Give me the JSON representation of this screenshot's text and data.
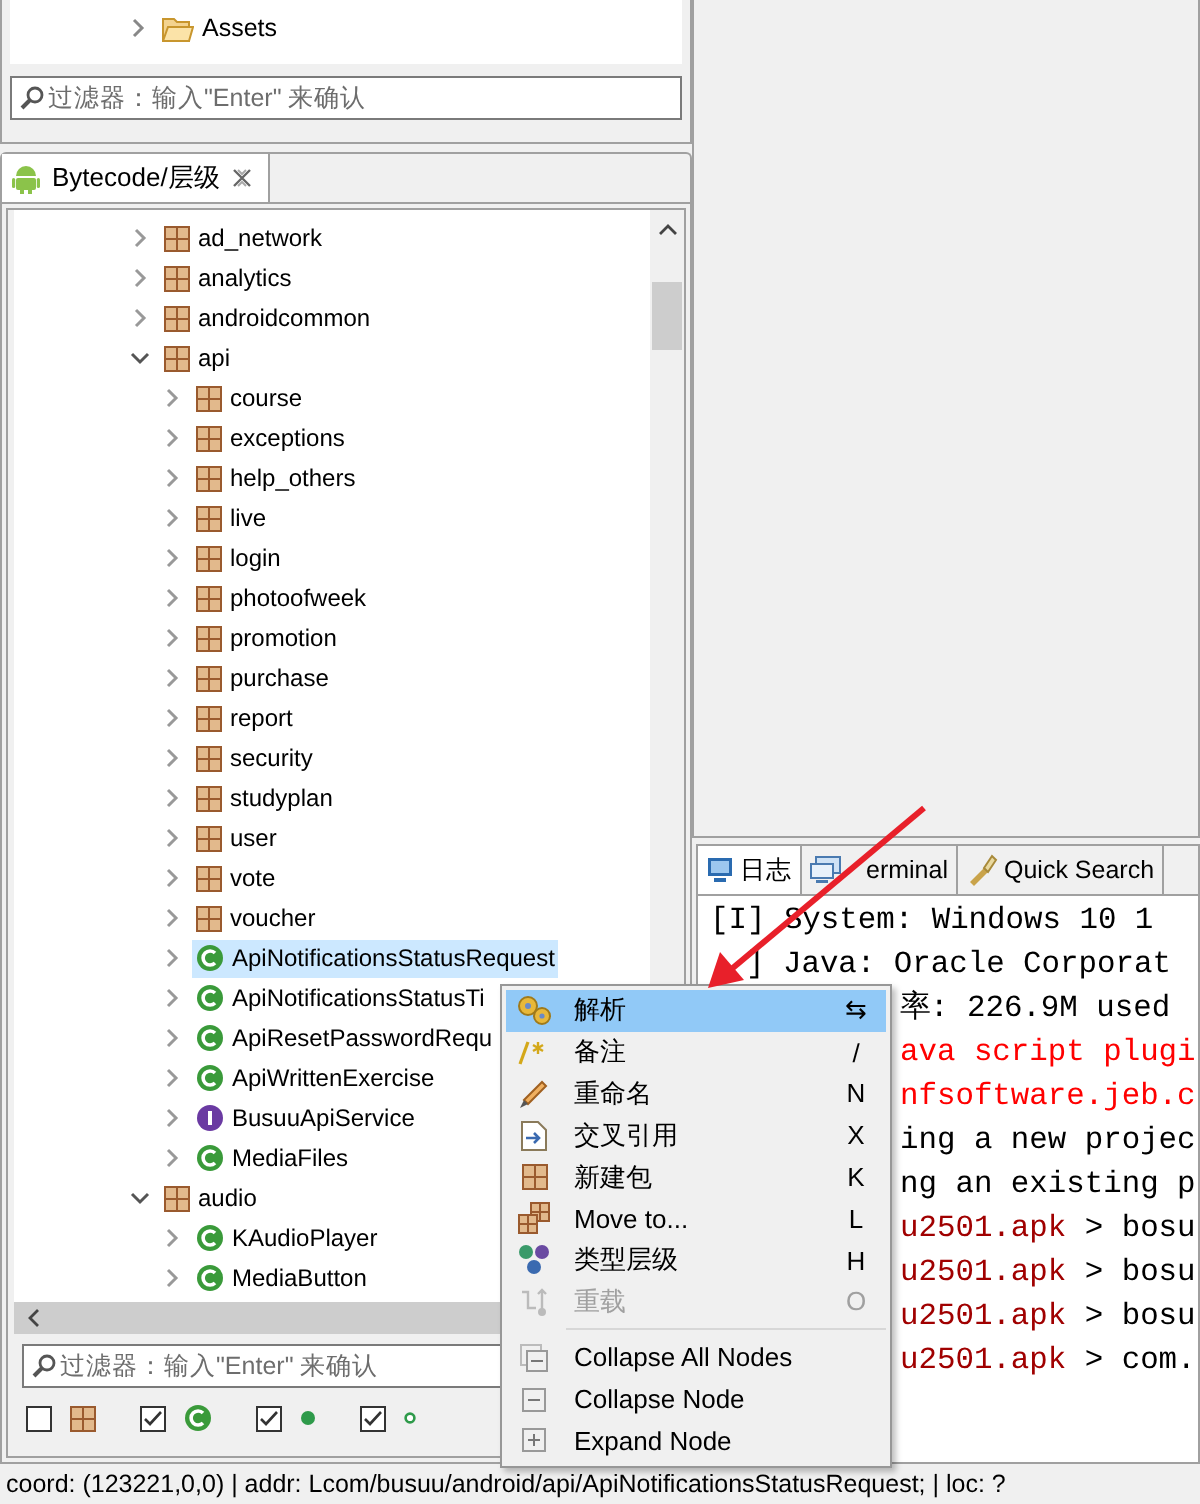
{
  "project_panel": {
    "tree": [
      {
        "label": "Assets",
        "kind": "folder",
        "expanded": false,
        "selected": false
      }
    ],
    "filter": {
      "placeholder": "过滤器：输入\"Enter\" 来确认"
    }
  },
  "bytecode_panel": {
    "tab": {
      "label": "Bytecode/层级",
      "selected": true
    },
    "tree": [
      {
        "label": "ad_network",
        "kind": "package",
        "expanded": false,
        "selected": false
      },
      {
        "label": "analytics",
        "kind": "package",
        "expanded": false,
        "selected": false
      },
      {
        "label": "androidcommon",
        "kind": "package",
        "expanded": false,
        "selected": false
      },
      {
        "label": "api",
        "kind": "package",
        "expanded": true,
        "selected": false,
        "children": [
          {
            "label": "course",
            "kind": "package",
            "expanded": false,
            "selected": false
          },
          {
            "label": "exceptions",
            "kind": "package",
            "expanded": false,
            "selected": false
          },
          {
            "label": "help_others",
            "kind": "package",
            "expanded": false,
            "selected": false
          },
          {
            "label": "live",
            "kind": "package",
            "expanded": false,
            "selected": false
          },
          {
            "label": "login",
            "kind": "package",
            "expanded": false,
            "selected": false
          },
          {
            "label": "photoofweek",
            "kind": "package",
            "expanded": false,
            "selected": false
          },
          {
            "label": "promotion",
            "kind": "package",
            "expanded": false,
            "selected": false
          },
          {
            "label": "purchase",
            "kind": "package",
            "expanded": false,
            "selected": false
          },
          {
            "label": "report",
            "kind": "package",
            "expanded": false,
            "selected": false
          },
          {
            "label": "security",
            "kind": "package",
            "expanded": false,
            "selected": false
          },
          {
            "label": "studyplan",
            "kind": "package",
            "expanded": false,
            "selected": false
          },
          {
            "label": "user",
            "kind": "package",
            "expanded": false,
            "selected": false
          },
          {
            "label": "vote",
            "kind": "package",
            "expanded": false,
            "selected": false
          },
          {
            "label": "voucher",
            "kind": "package",
            "expanded": false,
            "selected": false
          },
          {
            "label": "ApiNotificationsStatusRequest",
            "kind": "class",
            "expanded": false,
            "selected": true
          },
          {
            "label": "ApiNotificationsStatusTi",
            "kind": "class",
            "expanded": false,
            "selected": false
          },
          {
            "label": "ApiResetPasswordRequ",
            "kind": "class",
            "expanded": false,
            "selected": false
          },
          {
            "label": "ApiWrittenExercise",
            "kind": "class",
            "expanded": false,
            "selected": false
          },
          {
            "label": "BusuuApiService",
            "kind": "interface",
            "expanded": false,
            "selected": false
          },
          {
            "label": "MediaFiles",
            "kind": "class",
            "expanded": false,
            "selected": false
          }
        ]
      },
      {
        "label": "audio",
        "kind": "package",
        "expanded": true,
        "selected": false,
        "children": [
          {
            "label": "KAudioPlayer",
            "kind": "class",
            "expanded": false,
            "selected": false
          },
          {
            "label": "MediaButton",
            "kind": "class",
            "expanded": false,
            "selected": false
          }
        ]
      }
    ],
    "filter": {
      "placeholder": "过滤器：输入\"Enter\" 来确认"
    },
    "type_filters": [
      {
        "kind": "package",
        "checked": false
      },
      {
        "kind": "class",
        "checked": true
      },
      {
        "kind": "field",
        "checked": true
      },
      {
        "kind": "method",
        "checked": true
      }
    ]
  },
  "log_panel": {
    "tabs": [
      {
        "label": "日志",
        "kind": "log",
        "selected": true
      },
      {
        "label": "erminal",
        "kind": "terminal",
        "selected": false,
        "partial": true
      },
      {
        "label": "Quick Search",
        "kind": "search",
        "selected": false
      }
    ],
    "lines": [
      {
        "covered": false,
        "segments": [
          {
            "text": "[I] System: Windows 10 1",
            "color": "#000000"
          }
        ]
      },
      {
        "covered": false,
        "partial": true,
        "segments": [
          {
            "text": "] Java: Oracle Corporat",
            "color": "#000000"
          }
        ]
      },
      {
        "covered": true,
        "segments": [
          {
            "text": "率: 226.9M used",
            "color": "#000000"
          }
        ]
      },
      {
        "covered": true,
        "segments": [
          {
            "text": "ava script plugi",
            "color": "#ff0000"
          }
        ]
      },
      {
        "covered": true,
        "segments": [
          {
            "text": "nfsoftware.jeb.c",
            "color": "#ff0000"
          }
        ]
      },
      {
        "covered": true,
        "segments": [
          {
            "text": "ing a new projec",
            "color": "#000000"
          }
        ]
      },
      {
        "covered": true,
        "segments": [
          {
            "text": "ng an existing p",
            "color": "#000000"
          }
        ]
      },
      {
        "covered": true,
        "segments": [
          {
            "text": "u2501.apk",
            "color": "#a00000"
          },
          {
            "text": " > bosu",
            "color": "#000000"
          }
        ]
      },
      {
        "covered": true,
        "segments": [
          {
            "text": "u2501.apk",
            "color": "#a00000"
          },
          {
            "text": " > bosu",
            "color": "#000000"
          }
        ]
      },
      {
        "covered": true,
        "segments": [
          {
            "text": "u2501.apk",
            "color": "#a00000"
          },
          {
            "text": " > bosu",
            "color": "#000000"
          }
        ]
      },
      {
        "covered": true,
        "segments": [
          {
            "text": "u2501.apk",
            "color": "#a00000"
          },
          {
            "text": " > com.",
            "color": "#000000"
          }
        ]
      }
    ]
  },
  "context_menu": {
    "items": [
      {
        "kind": "decompile",
        "label": "解析",
        "shortcut": "⇆",
        "selected": true,
        "disabled": false
      },
      {
        "kind": "comment",
        "label": "备注",
        "shortcut": "/",
        "selected": false,
        "disabled": false
      },
      {
        "kind": "rename",
        "label": "重命名",
        "shortcut": "N",
        "selected": false,
        "disabled": false
      },
      {
        "kind": "xref",
        "label": "交叉引用",
        "shortcut": "X",
        "selected": false,
        "disabled": false
      },
      {
        "kind": "new_package",
        "label": "新建包",
        "shortcut": "K",
        "selected": false,
        "disabled": false
      },
      {
        "kind": "move",
        "label": "Move to...",
        "shortcut": "L",
        "selected": false,
        "disabled": false
      },
      {
        "kind": "hierarchy",
        "label": "类型层级",
        "shortcut": "H",
        "selected": false,
        "disabled": false
      },
      {
        "kind": "overrides",
        "label": "重载",
        "shortcut": "O",
        "selected": false,
        "disabled": true
      },
      {
        "kind": "separator"
      },
      {
        "kind": "collapse_all",
        "label": "Collapse All Nodes",
        "selected": false,
        "disabled": false
      },
      {
        "kind": "collapse",
        "label": "Collapse Node",
        "selected": false,
        "disabled": false
      },
      {
        "kind": "expand",
        "label": "Expand Node",
        "selected": false,
        "disabled": false
      }
    ]
  },
  "status_bar": {
    "text": "coord: (123221,0,0) | addr: Lcom/busuu/android/api/ApiNotificationsStatusRequest; | loc: ?"
  }
}
